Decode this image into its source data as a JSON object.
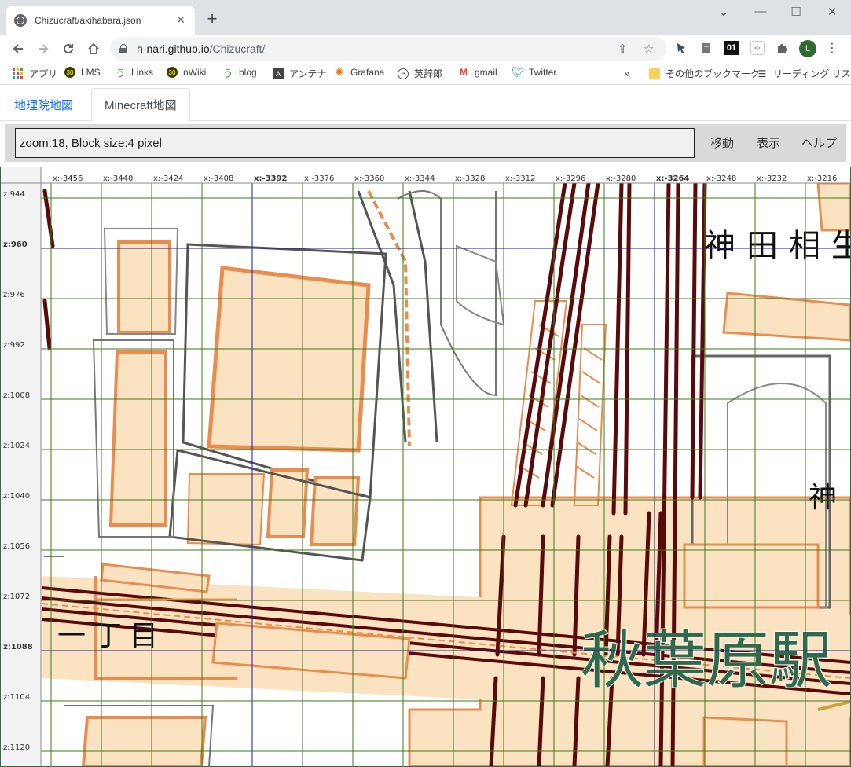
{
  "browser": {
    "tab_title": "Chizucraft/akihabara.json",
    "new_tab": "+",
    "url_host": "h-nari.github.io",
    "url_path": "/Chizucraft/",
    "window_controls": {
      "minimize": "—",
      "maximize": "☐",
      "close": "✕",
      "tab_list": "⌄"
    }
  },
  "bookmarks": [
    {
      "label": "アプリ",
      "icon": "apps-grid-icon"
    },
    {
      "label": "LMS",
      "icon": "lms-icon"
    },
    {
      "label": "Links",
      "icon": "links-icon"
    },
    {
      "label": "nWiki",
      "icon": "nwiki-icon"
    },
    {
      "label": "blog",
      "icon": "blog-icon"
    },
    {
      "label": "アンテナ",
      "icon": "antenna-icon"
    },
    {
      "label": "Grafana",
      "icon": "grafana-icon"
    },
    {
      "label": "英辞郎",
      "icon": "eijiro-icon"
    },
    {
      "label": "gmail",
      "icon": "gmail-icon"
    },
    {
      "label": "Twitter",
      "icon": "twitter-icon"
    }
  ],
  "bookmarks_more": "»",
  "bookmarks_other": "その他のブックマーク",
  "reading_list": "リーディング リスト",
  "avatar_letter": "L",
  "ext_01": "01",
  "page_tabs": {
    "gsi": "地理院地図",
    "minecraft": "Minecraft地図"
  },
  "control": {
    "status": "zoom:18, Block size:4 pixel",
    "move": "移動",
    "display": "表示",
    "help": "ヘルプ"
  },
  "map": {
    "x_labels": [
      "x:-3456",
      "x:-3440",
      "x:-3424",
      "x:-3408",
      "x:-3392",
      "x:-3376",
      "x:-3360",
      "x:-3344",
      "x:-3328",
      "x:-3312",
      "x:-3296",
      "x:-3280",
      "x:-3264",
      "x:-3248",
      "x:-3232",
      "x:-3216"
    ],
    "z_labels": [
      "z:944",
      "z:960",
      "z:976",
      "z:992",
      "z:1008",
      "z:1024",
      "z:1040",
      "z:1056",
      "z:1072",
      "z:1088",
      "z:1104",
      "z:1120"
    ],
    "bold_x": [
      "x:-3392",
      "x:-3264"
    ],
    "bold_z": [
      "z:960",
      "z:1088"
    ],
    "place_labels": {
      "kanda_aioi": "神田相生",
      "kanda": "神",
      "chome": "一丁目",
      "akihabara": "秋葉原駅"
    },
    "colors": {
      "grid_minor": "#3d7a1a",
      "grid_major": "#1a1aa0",
      "building_fill": "#fbe3c2",
      "building_edge": "#e98c4e",
      "road": "#6b6b6b",
      "rail": "#5a0a0a",
      "station_text": "#2f6b4a"
    }
  }
}
